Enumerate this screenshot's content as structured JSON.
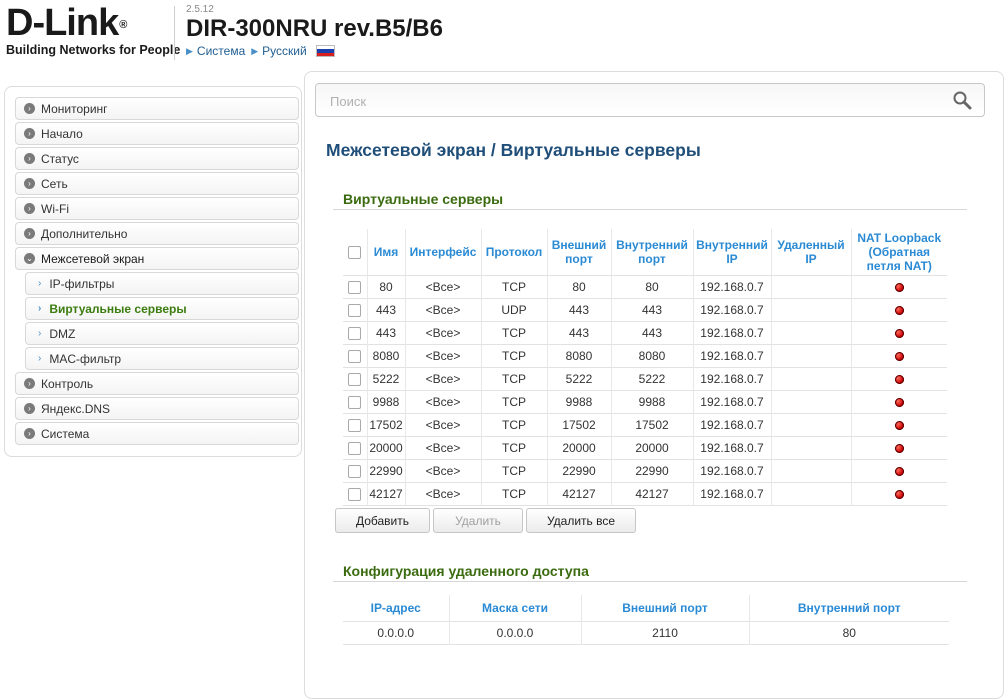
{
  "header": {
    "logo_text": "D-Link",
    "logo_registered": "®",
    "tagline": "Building Networks for People",
    "firmware": "2.5.12",
    "model": "DIR-300NRU rev.B5/B6",
    "crumbs": [
      "Система",
      "Русский"
    ]
  },
  "sidebar": {
    "items": [
      {
        "label": "Мониторинг"
      },
      {
        "label": "Начало"
      },
      {
        "label": "Статус"
      },
      {
        "label": "Сеть"
      },
      {
        "label": "Wi-Fi"
      },
      {
        "label": "Дополнительно"
      },
      {
        "label": "Межсетевой экран"
      },
      {
        "label": "IP-фильтры"
      },
      {
        "label": "Виртуальные серверы"
      },
      {
        "label": "DMZ"
      },
      {
        "label": "MAC-фильтр"
      },
      {
        "label": "Контроль"
      },
      {
        "label": "Яндекс.DNS"
      },
      {
        "label": "Система"
      }
    ]
  },
  "search": {
    "placeholder": "Поиск"
  },
  "page_title": "Межсетевой экран /  Виртуальные серверы",
  "virtual_servers": {
    "section_title": "Виртуальные серверы",
    "columns": [
      "Имя",
      "Интерфейс",
      "Протокол",
      "Внешний порт",
      "Внутренний порт",
      "Внутренний IP",
      "Удаленный IP",
      "NAT Loopback (Обратная петля NAT)"
    ],
    "rows": [
      {
        "name": "80",
        "iface": "<Все>",
        "proto": "TCP",
        "ext": "80",
        "int": "80",
        "ip": "192.168.0.7",
        "remote": ""
      },
      {
        "name": "443",
        "iface": "<Все>",
        "proto": "UDP",
        "ext": "443",
        "int": "443",
        "ip": "192.168.0.7",
        "remote": ""
      },
      {
        "name": "443",
        "iface": "<Все>",
        "proto": "TCP",
        "ext": "443",
        "int": "443",
        "ip": "192.168.0.7",
        "remote": ""
      },
      {
        "name": "8080",
        "iface": "<Все>",
        "proto": "TCP",
        "ext": "8080",
        "int": "8080",
        "ip": "192.168.0.7",
        "remote": ""
      },
      {
        "name": "5222",
        "iface": "<Все>",
        "proto": "TCP",
        "ext": "5222",
        "int": "5222",
        "ip": "192.168.0.7",
        "remote": ""
      },
      {
        "name": "9988",
        "iface": "<Все>",
        "proto": "TCP",
        "ext": "9988",
        "int": "9988",
        "ip": "192.168.0.7",
        "remote": ""
      },
      {
        "name": "17502",
        "iface": "<Все>",
        "proto": "TCP",
        "ext": "17502",
        "int": "17502",
        "ip": "192.168.0.7",
        "remote": ""
      },
      {
        "name": "20000",
        "iface": "<Все>",
        "proto": "TCP",
        "ext": "20000",
        "int": "20000",
        "ip": "192.168.0.7",
        "remote": ""
      },
      {
        "name": "22990",
        "iface": "<Все>",
        "proto": "TCP",
        "ext": "22990",
        "int": "22990",
        "ip": "192.168.0.7",
        "remote": ""
      },
      {
        "name": "42127",
        "iface": "<Все>",
        "proto": "TCP",
        "ext": "42127",
        "int": "42127",
        "ip": "192.168.0.7",
        "remote": ""
      }
    ],
    "buttons": {
      "add": "Добавить",
      "delete": "Удалить",
      "delete_all": "Удалить все"
    }
  },
  "remote_access": {
    "section_title": "Конфигурация удаленного доступа",
    "columns": [
      "IP-адрес",
      "Маска сети",
      "Внешний порт",
      "Внутренний порт"
    ],
    "rows": [
      {
        "ip": "0.0.0.0",
        "mask": "0.0.0.0",
        "ext": "2110",
        "int": "80"
      }
    ]
  },
  "colors": {
    "title_blue": "#1f4e79",
    "section_green": "#3b6b10",
    "header_link_blue": "#2a8ad4",
    "nat_led_red": "#c60000"
  }
}
